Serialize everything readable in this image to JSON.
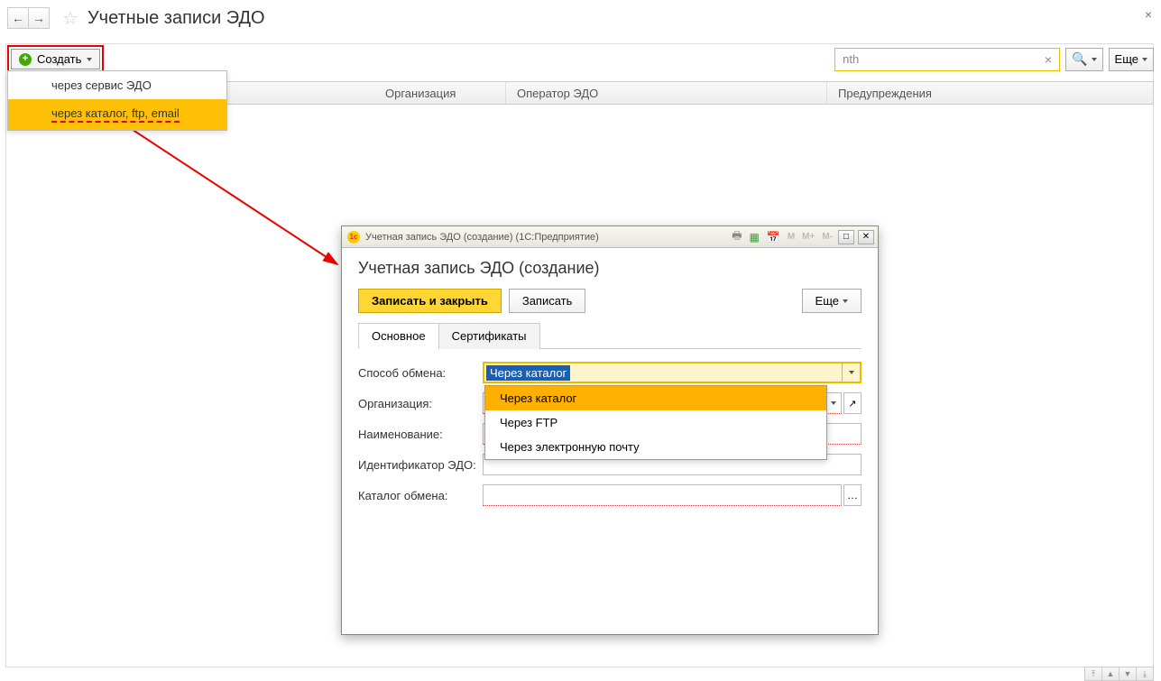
{
  "nav": {
    "title": "Учетные записи ЭДО"
  },
  "toolbar": {
    "create_label": "Создать",
    "search_value": "nth",
    "more_label": "Еще"
  },
  "create_menu": {
    "items": [
      "через сервис ЭДО",
      "через каталог, ftp, email"
    ]
  },
  "table": {
    "columns": [
      "Организация",
      "Оператор ЭДО",
      "Предупреждения"
    ]
  },
  "dialog": {
    "window_title": "Учетная запись ЭДО (создание)  (1С:Предприятие)",
    "m_labels": [
      "M",
      "M+",
      "M-"
    ],
    "heading": "Учетная запись ЭДО (создание)",
    "save_close": "Записать и закрыть",
    "save": "Записать",
    "more": "Еще",
    "tabs": [
      "Основное",
      "Сертификаты"
    ],
    "fields": {
      "exchange_method": "Способ обмена:",
      "organization": "Организация:",
      "name": "Наименование:",
      "edo_id": "Идентификатор ЭДО:",
      "catalog": "Каталог обмена:"
    },
    "exchange_select": {
      "value": "Через каталог",
      "options": [
        "Через каталог",
        "Через FTP",
        "Через электронную почту"
      ]
    }
  }
}
